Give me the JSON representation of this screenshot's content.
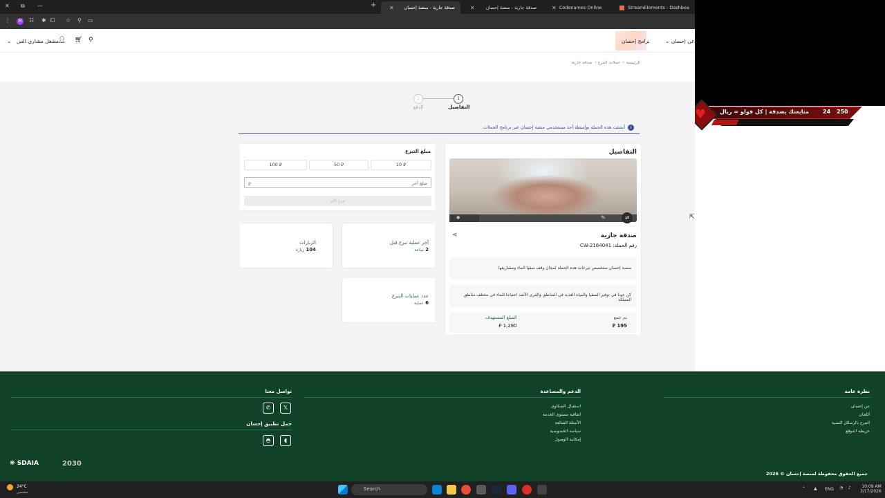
{
  "browser": {
    "tabs": [
      {
        "label": "صدقة جارية - منصة إحسان",
        "active": true
      },
      {
        "label": "صدقة جارية - منصة إحسان",
        "active": false
      },
      {
        "label": "Codenames Online",
        "active": false
      },
      {
        "label": "StreamElements - Dashboard",
        "active": false
      }
    ],
    "profile_initial": "M"
  },
  "overlay": {
    "text": "متابعتك بصدقة | كل فولو = ريال",
    "count_a": "24",
    "count_b": "250"
  },
  "header": {
    "about": "عن إحسان",
    "programs": "برامج إحسان",
    "user": "مشعل مشاري الس..."
  },
  "breadcrumb": [
    "الرئيسية",
    "حملات التبرع",
    "صدقة جارية"
  ],
  "steps": [
    {
      "num": "1",
      "label": "التفاصيل"
    },
    {
      "num": "2",
      "label": "الدفع"
    }
  ],
  "notice": "أنشئت هذه الحملة بواسطة أحد مستخدمي منصة إحسان عبر برنامج الحملات.",
  "details": {
    "title": "التفاصيل",
    "progress_label": "%",
    "progress": 0.16,
    "campaign_name": "صدقة جارية",
    "campaign_no_label": "رقم الحملة:",
    "campaign_no": "CW-2164041",
    "desc1": "منصة إحسان ستخصص تبرعات هذه الحملة لمجال وقف سقيا الماء ومشاريعها",
    "desc2": "كن عونا في توفير السقيا والمياه العذبة في المناطق والقرى الأشد احتياجا للماء في مختلف مناطق المملكة",
    "collected_label": "تم جمع",
    "collected": "195",
    "target_label": "المبلغ المستهدف",
    "target": "1,280"
  },
  "donate": {
    "title": "مبلغ التبرع",
    "amounts": [
      "10",
      "50",
      "100"
    ],
    "other_placeholder": "مبلغ آخر",
    "button": "تبرع الآن",
    "currency_symbol": "⃁"
  },
  "stats": {
    "last_label": "آخر عملية تبرع قبل",
    "last_value": "2",
    "last_unit": "ساعة",
    "visits_label": "الزيارات",
    "visits_value": "104",
    "visits_unit": "زيارة",
    "ops_label": "عدد عمليات التبرع",
    "ops_value": "6",
    "ops_unit": "عملية"
  },
  "footer": {
    "overview_title": "نظرة عامة",
    "overview_links": [
      "عن إحسان",
      "اللجان",
      "التبرع بالرسائل النصية",
      "خريطة الموقع"
    ],
    "support_title": "الدعم والمساعدة",
    "support_links": [
      "استقبال الشكاوى",
      "اتفاقية مستوى الخدمة",
      "الأسئلة الشائعة",
      "سياسة الخصوصية",
      "إمكانية الوصول"
    ],
    "contact_title": "تواصل معنا",
    "app_title": "حمل تطبيق إحسان",
    "copyright": "جميع الحقوق محفوظة لمنصة إحسان © 2026",
    "sdaia": "SDAIA",
    "vision": "2030"
  },
  "taskbar": {
    "weather_temp": "24°C",
    "weather_desc": "مشمس",
    "search": "Search",
    "lang": "ENG",
    "time": "10:09 AM",
    "date": "3/17/2026"
  }
}
